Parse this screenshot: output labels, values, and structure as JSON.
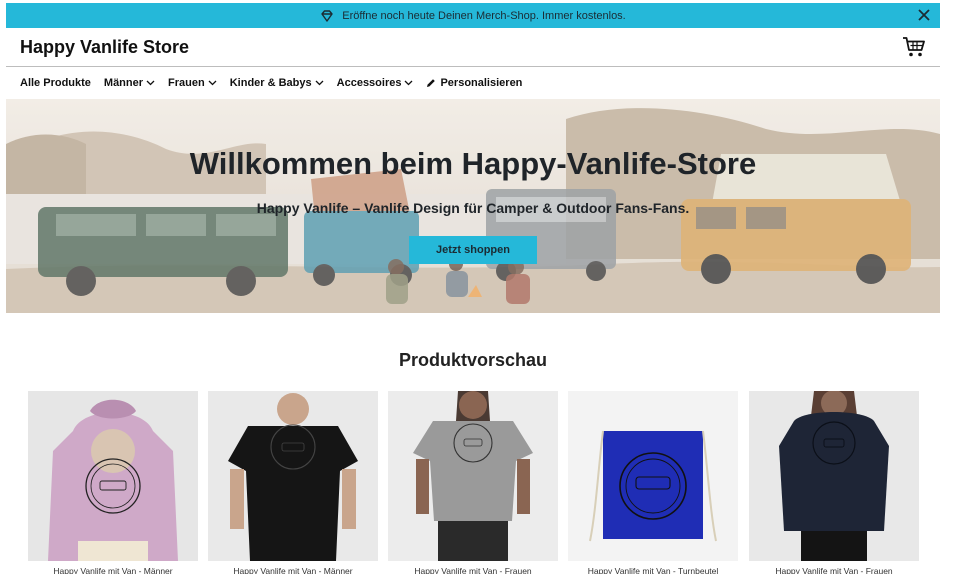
{
  "promo": {
    "text": "Eröffne noch heute Deinen Merch-Shop. Immer kostenlos.",
    "icon": "diamond-icon",
    "bg_color": "#25b8d9"
  },
  "header": {
    "store_name": "Happy Vanlife Store",
    "cart_icon": "cart-icon"
  },
  "nav": {
    "items": [
      {
        "label": "Alle Produkte",
        "has_dropdown": false
      },
      {
        "label": "Männer",
        "has_dropdown": true
      },
      {
        "label": "Frauen",
        "has_dropdown": true
      },
      {
        "label": "Kinder & Babys",
        "has_dropdown": true
      },
      {
        "label": "Accessoires",
        "has_dropdown": true
      },
      {
        "label": "Personalisieren",
        "has_dropdown": false,
        "icon": "pencil-icon"
      }
    ]
  },
  "hero": {
    "title": "Willkommen beim Happy-Vanlife-Store",
    "subtitle": "Happy Vanlife – Vanlife Design für Camper & Outdoor Fans-Fans.",
    "cta_label": "Jetzt shoppen"
  },
  "preview": {
    "title": "Produktvorschau",
    "products": [
      {
        "name": "Happy Vanlife mit Van - Männer",
        "garment_color": "#cfa9c8"
      },
      {
        "name": "Happy Vanlife mit Van - Männer",
        "garment_color": "#151515"
      },
      {
        "name": "Happy Vanlife mit Van - Frauen",
        "garment_color": "#9a9a9a"
      },
      {
        "name": "Happy Vanlife mit Van - Turnbeutel",
        "garment_color": "#1f2db5"
      },
      {
        "name": "Happy Vanlife mit Van - Frauen",
        "garment_color": "#1e2536"
      }
    ]
  }
}
